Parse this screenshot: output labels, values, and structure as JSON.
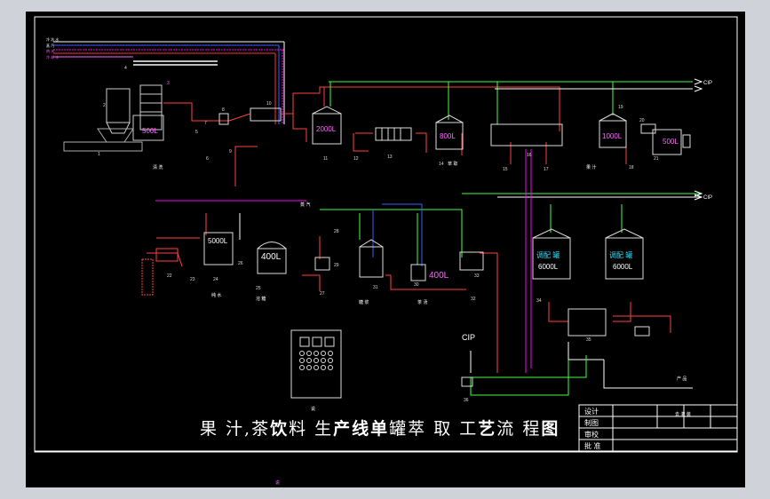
{
  "drawing": {
    "title_parts": [
      "果 汁,茶",
      "饮",
      "料 生",
      "产线单",
      "罐萃 取 工",
      "艺",
      "流 程",
      "图"
    ],
    "title_block": {
      "row1": "设计",
      "row2": "制图",
      "row3": "审校",
      "row4": "批 准"
    },
    "cip_labels": [
      "CIP",
      "CIP",
      "CIP"
    ],
    "small_cip_arrow": "CIP",
    "tanks": {
      "t500a": "500L",
      "t2000": "2000L",
      "t800": "800L",
      "t1000": "1000L",
      "t500b": "500L",
      "t5000": "5000L",
      "t400a": "400L",
      "t400b": "400L",
      "t6000a_top": "调配 罐",
      "t6000a_vol": "6000L",
      "t6000b_top": "调配 罐",
      "t6000b_vol": "6000L"
    },
    "numbers": {
      "n1": "1",
      "n2": "2",
      "n3": "3",
      "n4": "4",
      "n5": "5",
      "n6": "6",
      "n7": "7",
      "n8": "8",
      "n9": "9",
      "n10": "10",
      "n11": "11",
      "n12": "12",
      "n13": "13",
      "n14": "14",
      "n15": "15",
      "n16": "16",
      "n17": "17",
      "n18": "18",
      "n19": "19",
      "n20": "20",
      "n21": "21",
      "n22": "22",
      "n23": "23",
      "n24": "24",
      "n25": "25",
      "n26": "26",
      "n27": "27",
      "n28": "28",
      "n29": "29",
      "n30": "30",
      "n31": "31",
      "n32": "32",
      "n33": "33",
      "n34": "34",
      "n35": "35",
      "n36": "36"
    },
    "legend_lines": [
      "冷 冻 水",
      "蒸 汽",
      "热 水",
      "冷 却 水"
    ],
    "small_labels": {
      "clean": "清 洗",
      "juice": "果 汁",
      "water": "纯 水",
      "sugar": "溶 糖",
      "syrup": "糖 浆",
      "tea": "茶 汤",
      "extract": "萃 取",
      "product": "产 品",
      "to_fill": "去 灌 装",
      "steam_in": "蒸 汽",
      "bottom1": "说",
      "bottom2": "说"
    }
  }
}
